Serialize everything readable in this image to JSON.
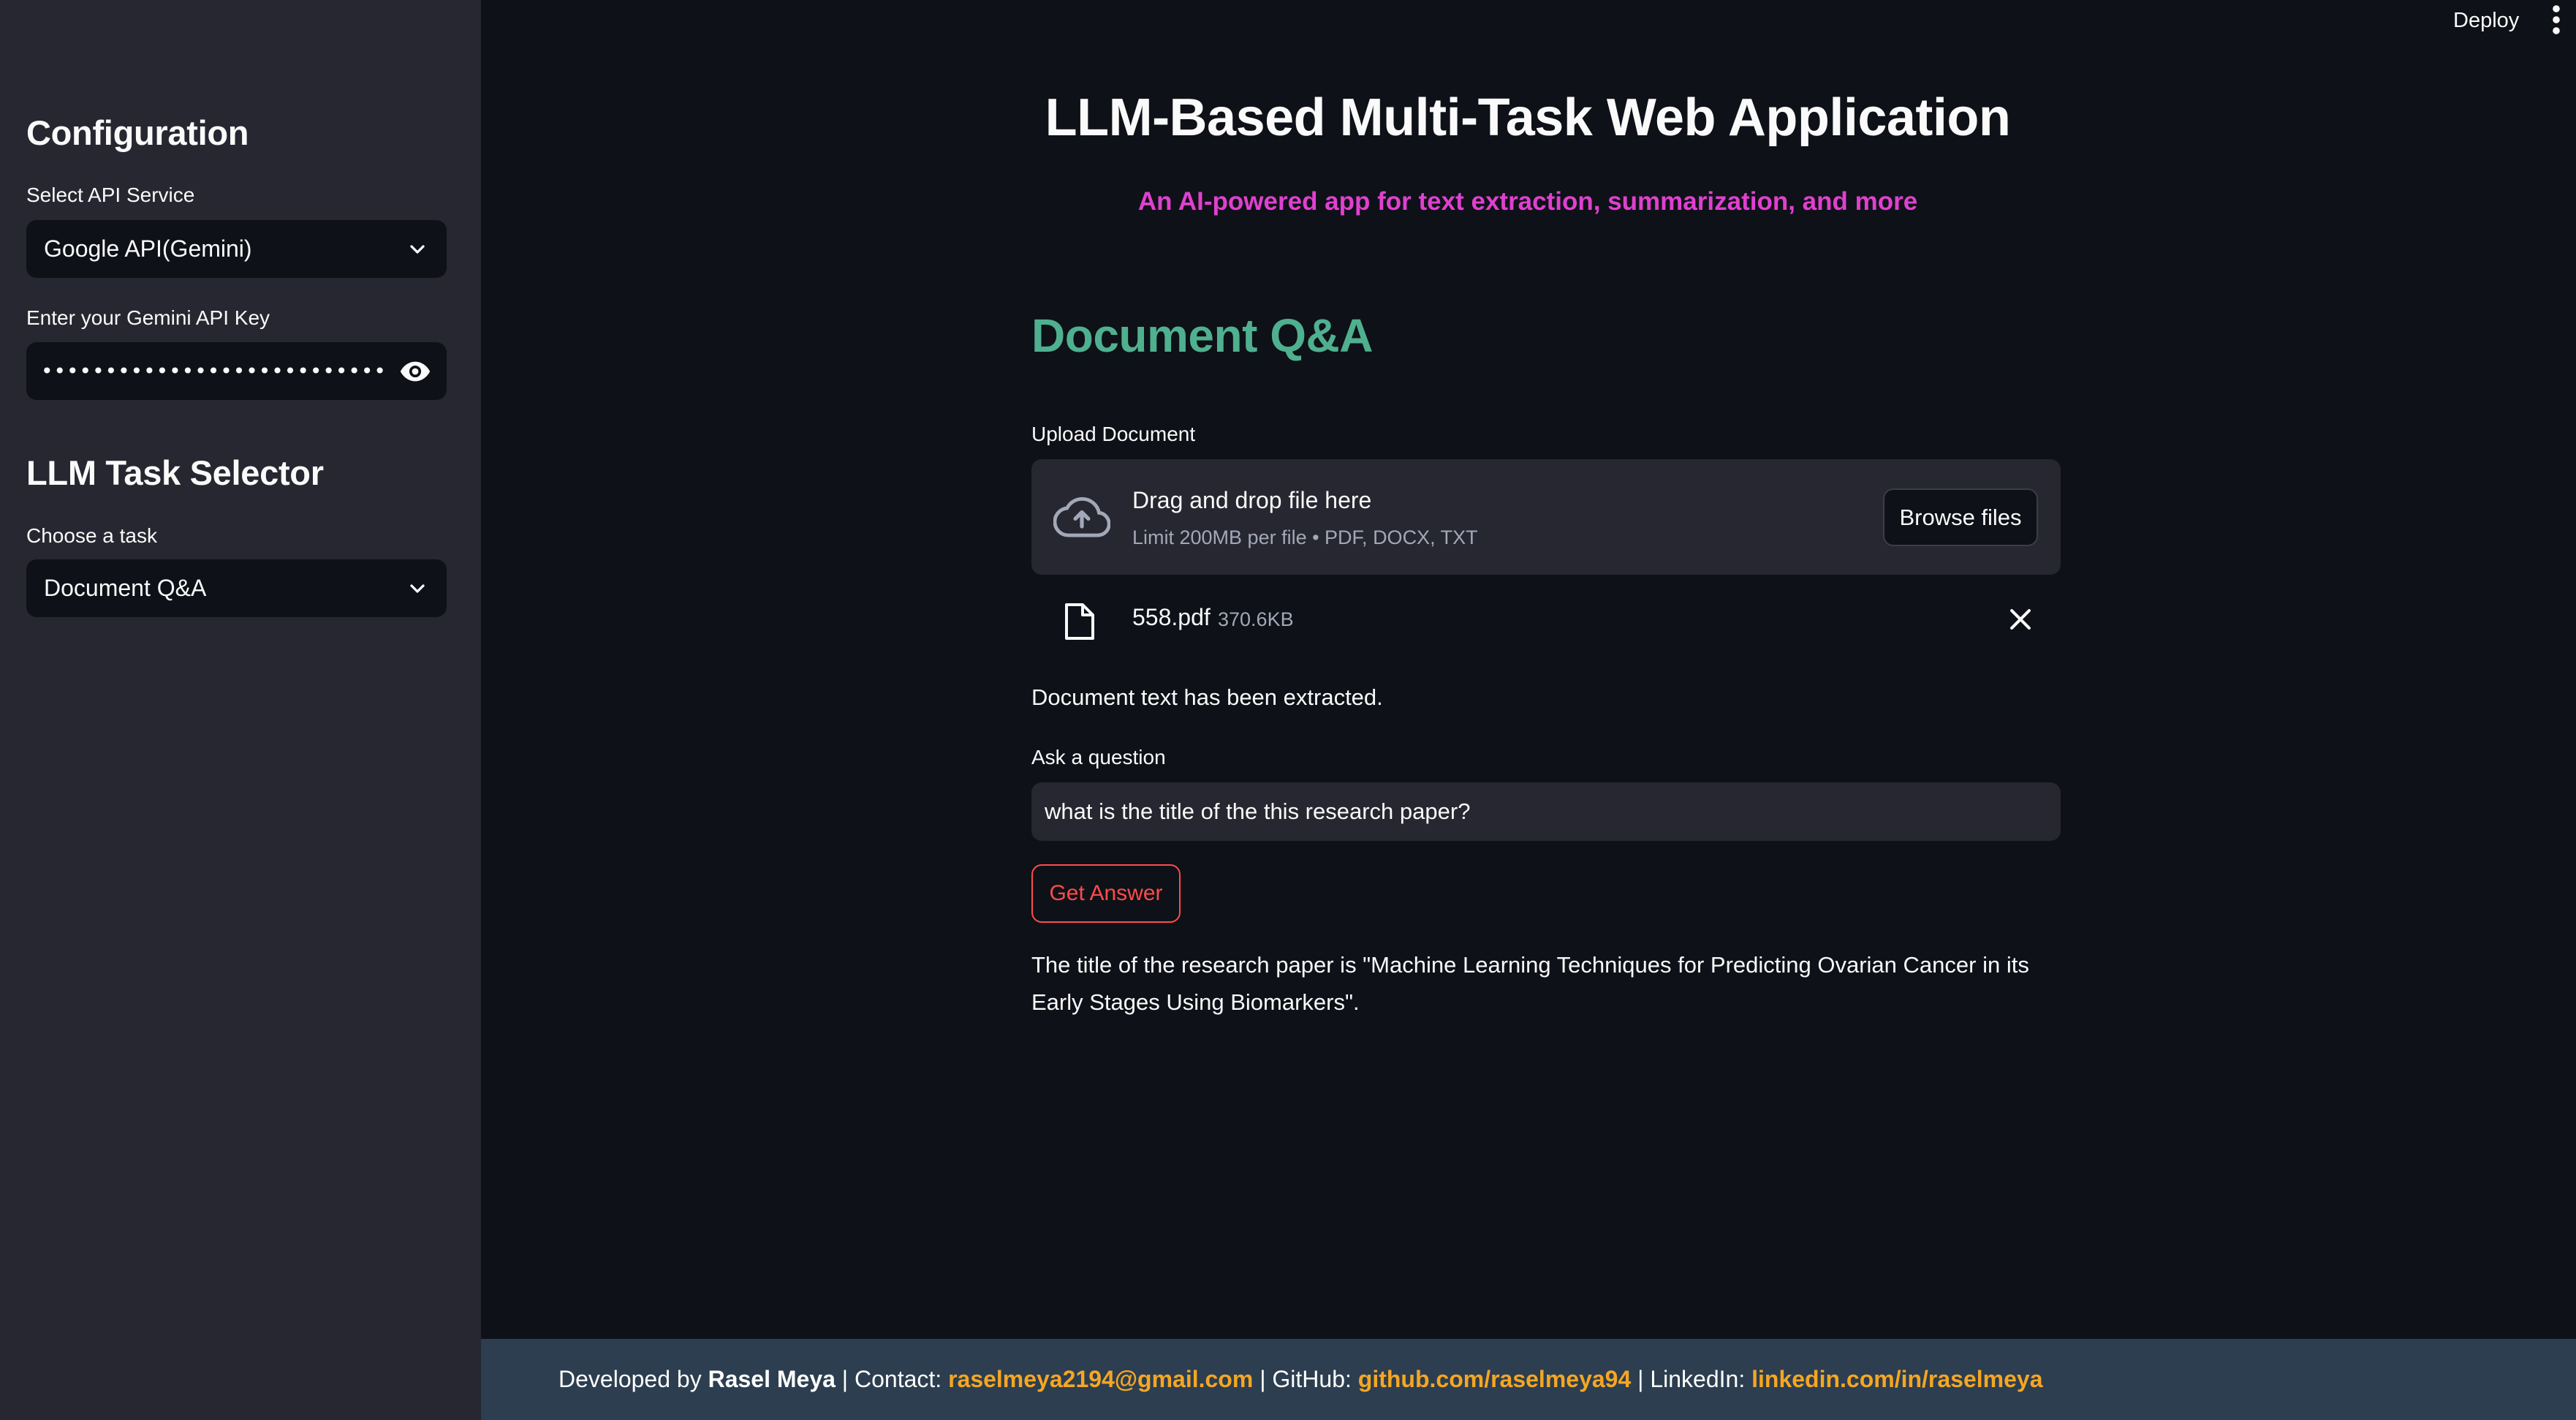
{
  "topbar": {
    "deploy_label": "Deploy",
    "menu_icon": "kebab-menu-icon"
  },
  "sidebar": {
    "config_heading": "Configuration",
    "api_service": {
      "label": "Select API Service",
      "value": "Google API(Gemini)"
    },
    "api_key": {
      "label": "Enter your Gemini API Key",
      "value": "••••••••••••••••••••••••••••••••••••••"
    },
    "task_heading": "LLM Task Selector",
    "task": {
      "label": "Choose a task",
      "value": "Document Q&A"
    }
  },
  "main": {
    "title": "LLM-Based Multi-Task Web Application",
    "subtitle": "An AI-powered app for text extraction, summarization, and more",
    "section_title": "Document Q&A",
    "upload": {
      "label": "Upload Document",
      "drop_text": "Drag and drop file here",
      "limit_text": "Limit 200MB per file • PDF, DOCX, TXT",
      "browse_label": "Browse files"
    },
    "file": {
      "name": "558.pdf",
      "size": "370.6KB"
    },
    "status": "Document text has been extracted.",
    "question": {
      "label": "Ask a question",
      "value": "what is the title of the this research paper?"
    },
    "get_answer_label": "Get Answer",
    "answer": "The title of the research paper is \"Machine Learning Techniques for Predicting Ovarian Cancer in its Early Stages Using Biomarkers\"."
  },
  "footer": {
    "developed_by": "Developed by",
    "author": "Rasel Meya",
    "contact_label": "| Contact:",
    "email": "raselmeya2194@gmail.com",
    "github_label": "| GitHub:",
    "github": "github.com/raselmeya94",
    "linkedin_label": "| LinkedIn:",
    "linkedin": "linkedin.com/in/raselmeya"
  },
  "colors": {
    "background": "#0e1117",
    "sidebar": "#262730",
    "subtitle": "#e040d0",
    "section_title": "#4fb08f",
    "primary_button": "#ff4b4b",
    "footer_bg": "#2c3e50",
    "footer_link": "#f5a623"
  }
}
